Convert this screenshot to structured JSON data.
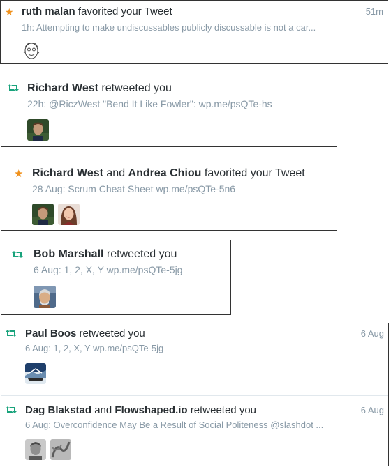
{
  "notifications": [
    {
      "type_icon": "star-icon",
      "type_glyph": "★",
      "actor1": "ruth malan",
      "conjunction": "",
      "actor2": "",
      "action": " favorited your Tweet",
      "time": "51m",
      "snippet": "1h: Attempting to make undiscussables publicly discussable is not a car...",
      "avatars": [
        "ruth-malan-avatar"
      ]
    },
    {
      "type_icon": "retweet-icon",
      "type_glyph": "⇄",
      "actor1": "Richard West",
      "conjunction": "",
      "actor2": "",
      "action": " retweeted you",
      "time": "",
      "snippet": "22h: @RiczWest \"Bend It Like Fowler\": wp.me/psQTe-hs",
      "avatars": [
        "richard-west-avatar"
      ]
    },
    {
      "type_icon": "star-icon",
      "type_glyph": "★",
      "actor1": "Richard West",
      "conjunction": " and ",
      "actor2": "Andrea Chiou",
      "action": " favorited your Tweet",
      "time": "",
      "snippet": "28 Aug: Scrum Cheat Sheet wp.me/psQTe-5n6",
      "avatars": [
        "richard-west-avatar",
        "andrea-chiou-avatar"
      ]
    },
    {
      "type_icon": "retweet-icon",
      "type_glyph": "⇄",
      "actor1": "Bob Marshall",
      "conjunction": "",
      "actor2": "",
      "action": " retweeted you",
      "time": "",
      "snippet": "6 Aug: 1, 2, X, Y wp.me/psQTe-5jg",
      "avatars": [
        "bob-marshall-avatar"
      ]
    },
    {
      "type_icon": "retweet-icon",
      "type_glyph": "⇄",
      "actor1": "Paul Boos",
      "conjunction": "",
      "actor2": "",
      "action": " retweeted you",
      "time": "6 Aug",
      "snippet": "6 Aug: 1, 2, X, Y wp.me/psQTe-5jg",
      "avatars": [
        "paul-boos-avatar"
      ]
    },
    {
      "type_icon": "retweet-icon",
      "type_glyph": "⇄",
      "actor1": "Dag Blakstad",
      "conjunction": " and ",
      "actor2": "Flowshaped.io",
      "action": " retweeted you",
      "time": "6 Aug",
      "snippet": "6 Aug: Overconfidence May Be a Result of Social Politeness @slashdot ...",
      "avatars": [
        "dag-blakstad-avatar",
        "flowshaped-io-avatar"
      ]
    }
  ],
  "colors": {
    "star": "#f0911c",
    "retweet": "#19a37c",
    "muted_text": "#8899a6",
    "name_text": "#292f33"
  }
}
